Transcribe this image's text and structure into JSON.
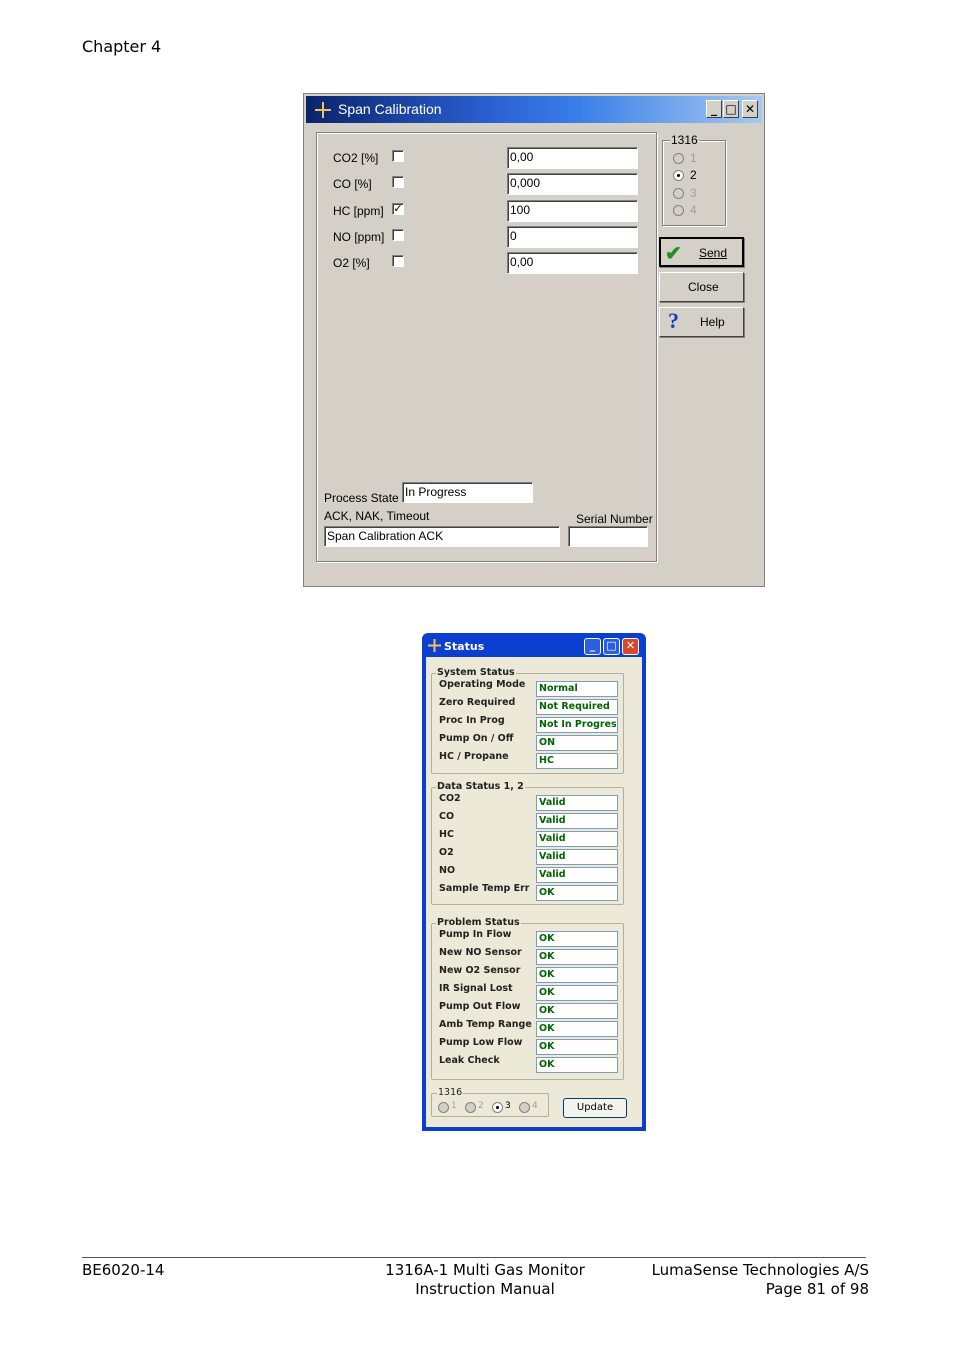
{
  "page": {
    "chapter": "Chapter 4",
    "footer": {
      "doc_id": "BE6020-14",
      "title_line1": "1316A-1 Multi Gas Monitor",
      "title_line2": "Instruction Manual",
      "company": "LumaSense Technologies A/S",
      "page_of": "Page 81 of 98"
    }
  },
  "span_window": {
    "title": "Span Calibration",
    "title_buttons": [
      "_",
      "□",
      "✕"
    ],
    "gases": [
      {
        "label": "CO2 [%]",
        "checked": false,
        "value": "0,00"
      },
      {
        "label": "CO [%]",
        "checked": false,
        "value": "0,000"
      },
      {
        "label": "HC [ppm]",
        "checked": true,
        "value": "100"
      },
      {
        "label": "NO [ppm]",
        "checked": false,
        "value": "0"
      },
      {
        "label": "O2 [%]",
        "checked": false,
        "value": "0,00"
      }
    ],
    "process_state_label": "Process State",
    "process_state_value": "In Progress",
    "ack_label": "ACK, NAK, Timeout",
    "ack_value": "Span Calibration  ACK",
    "serial_label": "Serial Number",
    "serial_value": "",
    "instrument_group": "1316",
    "instrument_options": [
      {
        "label": "1",
        "selected": false,
        "enabled": false
      },
      {
        "label": "2",
        "selected": true,
        "enabled": true
      },
      {
        "label": "3",
        "selected": false,
        "enabled": false
      },
      {
        "label": "4",
        "selected": false,
        "enabled": false
      }
    ],
    "send_label": "Send",
    "close_label": "Close",
    "help_label": "Help",
    "check_mark": "✔",
    "help_mark": "?"
  },
  "status_window": {
    "title": "Status",
    "system_status": {
      "title": "System Status",
      "rows": [
        {
          "label": "Operating Mode",
          "value": "Normal"
        },
        {
          "label": "Zero Required",
          "value": "Not Required"
        },
        {
          "label": "Proc In Prog",
          "value": "Not In Progress"
        },
        {
          "label": "Pump On / Off",
          "value": "ON"
        },
        {
          "label": "HC / Propane",
          "value": "HC"
        }
      ]
    },
    "data_status": {
      "title": "Data Status 1, 2",
      "rows": [
        {
          "label": "CO2",
          "value": "Valid"
        },
        {
          "label": "CO",
          "value": "Valid"
        },
        {
          "label": "HC",
          "value": "Valid"
        },
        {
          "label": "O2",
          "value": "Valid"
        },
        {
          "label": "NO",
          "value": "Valid"
        },
        {
          "label": "Sample Temp Err",
          "value": "OK"
        }
      ]
    },
    "problem_status": {
      "title": "Problem Status",
      "rows": [
        {
          "label": "Pump In Flow",
          "value": "OK"
        },
        {
          "label": "New NO Sensor",
          "value": "OK"
        },
        {
          "label": "New O2 Sensor",
          "value": "OK"
        },
        {
          "label": "IR Signal Lost",
          "value": "OK"
        },
        {
          "label": "Pump Out Flow",
          "value": "OK"
        },
        {
          "label": "Amb Temp Range",
          "value": "OK"
        },
        {
          "label": "Pump Low Flow",
          "value": "OK"
        },
        {
          "label": "Leak Check",
          "value": "OK"
        }
      ]
    },
    "instrument_group": "1316",
    "instrument_options": [
      {
        "label": "1",
        "selected": false
      },
      {
        "label": "2",
        "selected": false
      },
      {
        "label": "3",
        "selected": true
      },
      {
        "label": "4",
        "selected": false
      }
    ],
    "update_label": "Update"
  }
}
